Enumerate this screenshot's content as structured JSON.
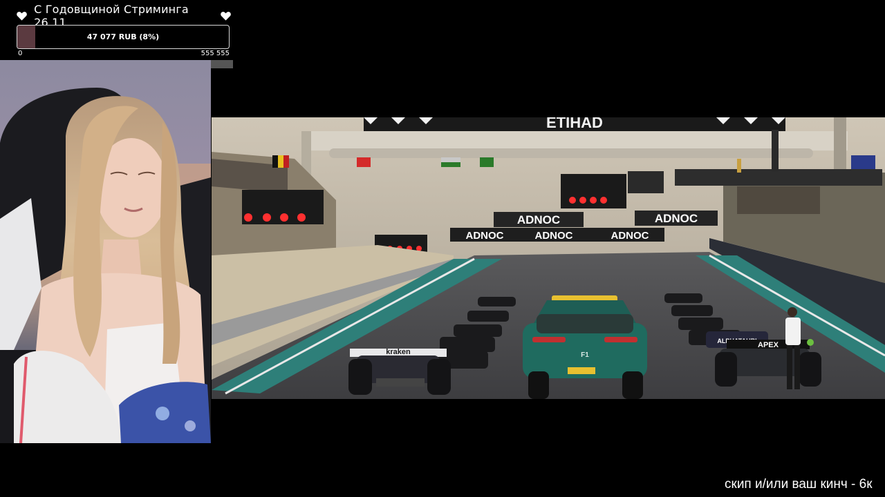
{
  "goal": {
    "title": "С Годовщиной Стриминга 26.11",
    "amount_label": "47 077 RUB (8%)",
    "current": 47077,
    "target": 555555,
    "progress_percent": 8,
    "scale_min": "0",
    "scale_max": "555 555",
    "fill_color": "#5b3a40"
  },
  "video": {
    "top_banner": "ETIHAD",
    "sponsor_boards": [
      "ADNOC",
      "ADNOC",
      "ADNOC",
      "ADNOC",
      "ADNOC"
    ],
    "car_labels": [
      "kraken",
      "ALPHATAURI",
      "APEX",
      "F1"
    ]
  },
  "ticker": {
    "text": "скип и/или ваш кинч - 6к"
  }
}
